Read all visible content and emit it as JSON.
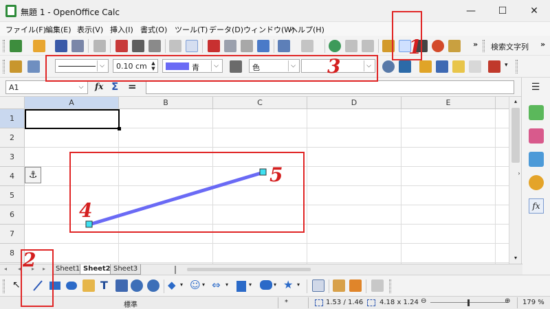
{
  "window": {
    "title": "無題 1 - OpenOffice Calc",
    "minimize": "—",
    "maximize": "☐",
    "close": "✕"
  },
  "menu": [
    "ファイル(F)",
    "編集(E)",
    "表示(V)",
    "挿入(I)",
    "書式(O)",
    "ツール(T)",
    "データ(D)",
    "ウィンドウ(W)",
    "ヘルプ(H)"
  ],
  "toolbar": {
    "search_label": "検索文字列",
    "more": "»"
  },
  "drawing_props": {
    "line_width": "0.10 cm",
    "line_color_name": "青",
    "line_color": "#6a6af5",
    "area_label": "色"
  },
  "formula": {
    "name_box": "A1",
    "fx": "fx",
    "sigma": "Σ",
    "equals": "="
  },
  "grid": {
    "columns": [
      "A",
      "B",
      "C",
      "D",
      "E"
    ],
    "rows": [
      "1",
      "2",
      "3",
      "4",
      "5",
      "6",
      "7",
      "8"
    ]
  },
  "sheets": [
    "Sheet1",
    "Sheet2",
    "Sheet3"
  ],
  "active_sheet": "Sheet2",
  "status": {
    "style": "標準",
    "modified": "*",
    "position": "1.53 / 1.46",
    "size": "4.18 x 1.24",
    "zoom": "179 %",
    "zoom_minus": "⊖",
    "zoom_plus": "⊕"
  },
  "annotations": {
    "n1": "1",
    "n2": "2",
    "n3": "3",
    "n4": "4",
    "n5": "5",
    "color": "#e02424"
  }
}
